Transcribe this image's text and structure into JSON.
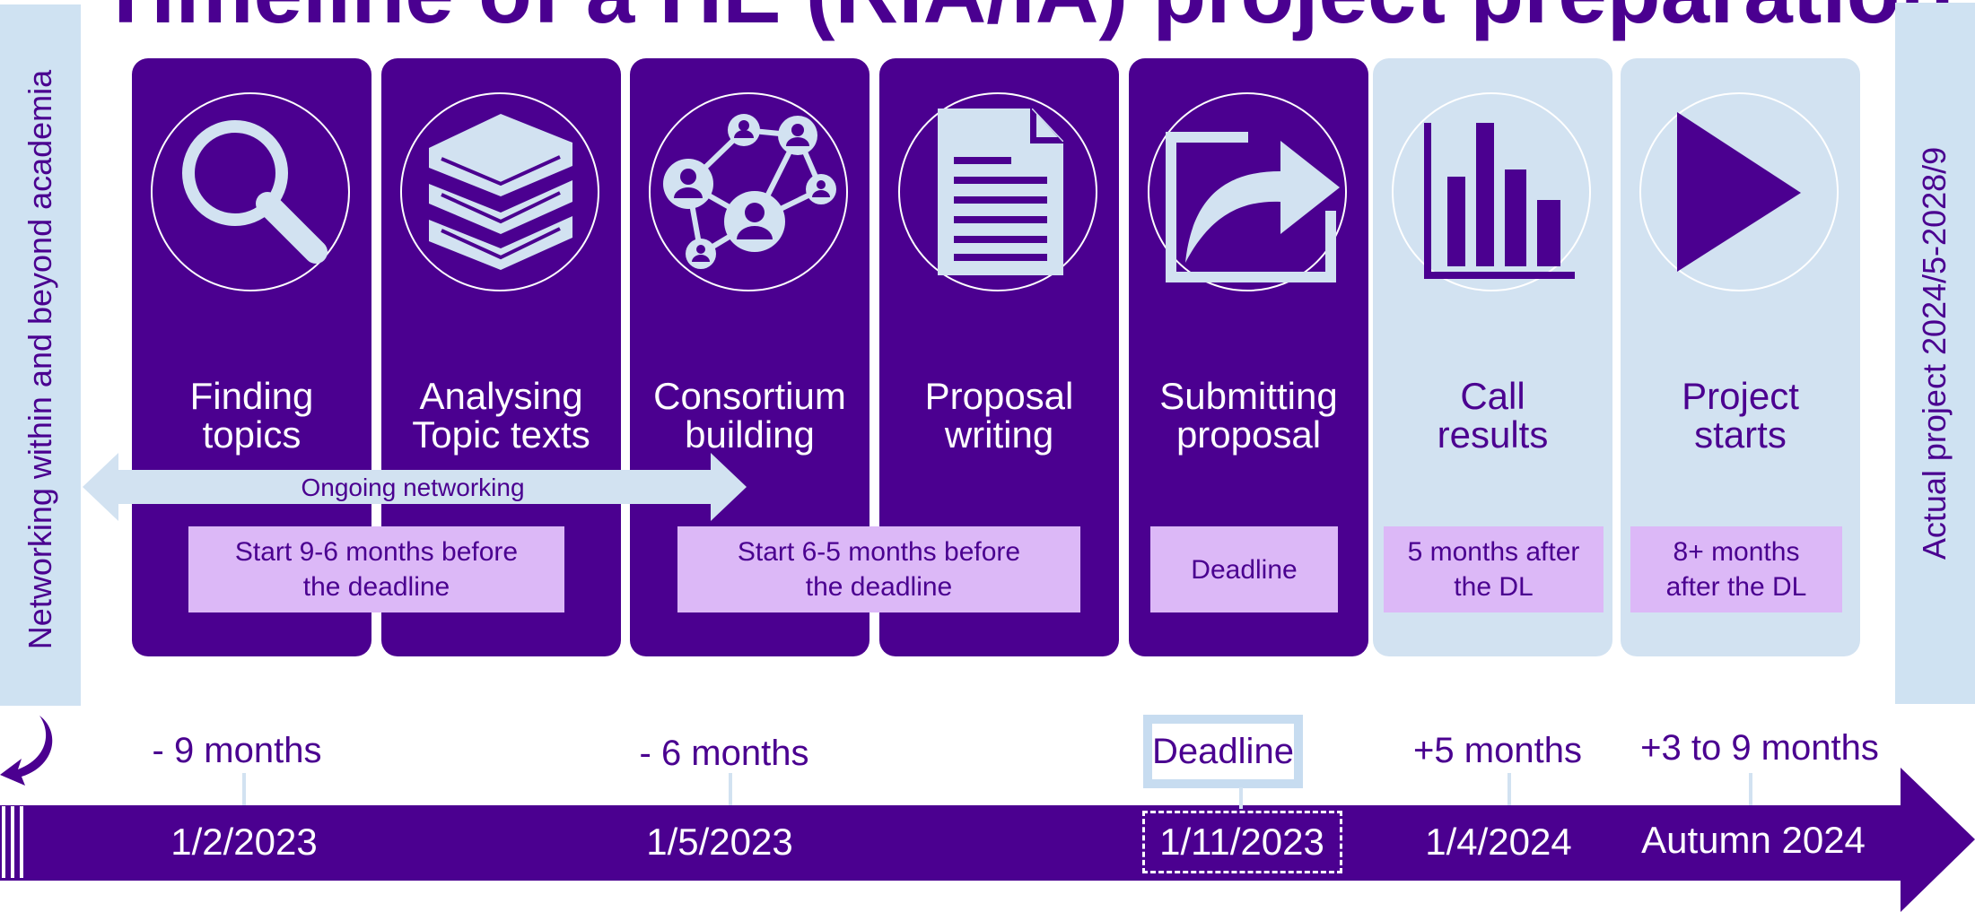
{
  "title": "Timeline of a HE (RIA/IA) project preparation",
  "side_left": "Networking within and beyond academia",
  "side_right": "Actual project 2024/5-2028/9",
  "colors": {
    "purple": "#4b0090",
    "light_blue": "#d2e2f1",
    "lavender": "#dcb8f7",
    "white": "#ffffff"
  },
  "stages": [
    {
      "label": "Finding\ntopics",
      "icon": "magnifier-icon",
      "phase": "preparation"
    },
    {
      "label": "Analysing\nTopic texts",
      "icon": "books-icon",
      "phase": "preparation"
    },
    {
      "label": "Consortium\nbuilding",
      "icon": "network-icon",
      "phase": "preparation"
    },
    {
      "label": "Proposal\nwriting",
      "icon": "document-icon",
      "phase": "preparation"
    },
    {
      "label": "Submitting\nproposal",
      "icon": "share-icon",
      "phase": "preparation"
    },
    {
      "label": "Call\nresults",
      "icon": "bar-chart-icon",
      "phase": "after-deadline"
    },
    {
      "label": "Project\nstarts",
      "icon": "play-icon",
      "phase": "after-deadline"
    }
  ],
  "timing_notes": [
    "Start 9-6 months before\nthe deadline",
    "Start 6-5 months before\nthe deadline",
    "Deadline",
    "5 months after\nthe DL",
    "8+ months\nafter the DL"
  ],
  "networking_label": "Ongoing networking",
  "timeline": {
    "ticks": [
      "- 9 months",
      "- 6 months",
      "Deadline",
      "+5 months",
      "+3 to 9 months"
    ],
    "dates": [
      "1/2/2023",
      "1/5/2023",
      "1/11/2023",
      "1/4/2024",
      "Autumn 2024"
    ]
  }
}
